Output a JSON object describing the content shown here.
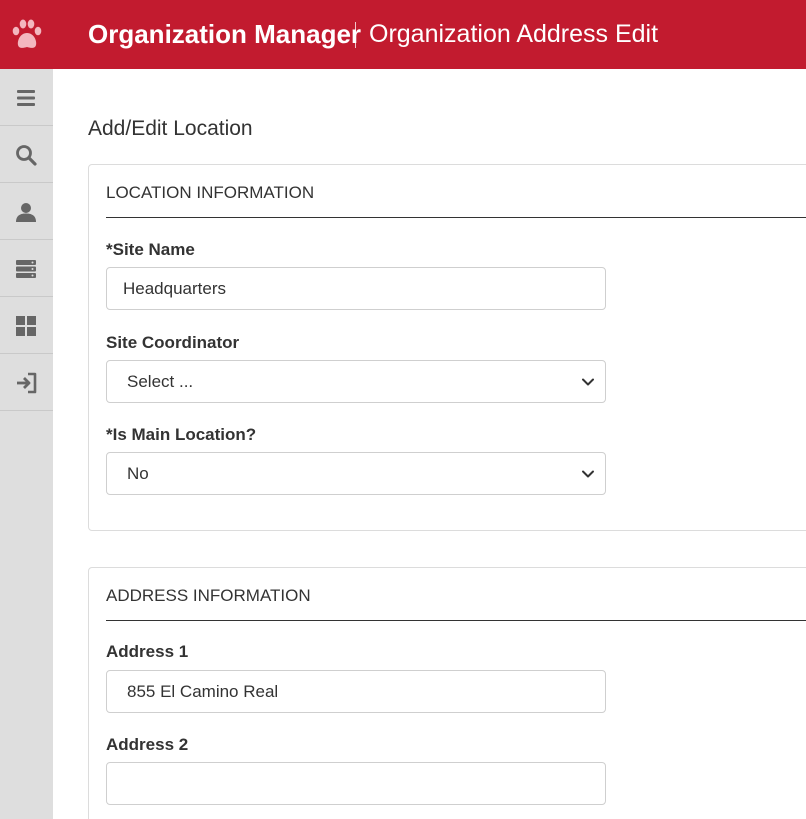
{
  "header": {
    "app_title": "Organization Manager",
    "page_title": "Organization Address Edit",
    "brand_color": "#c21b2f"
  },
  "sidebar": {
    "items": [
      {
        "icon": "menu-icon"
      },
      {
        "icon": "search-icon"
      },
      {
        "icon": "user-icon"
      },
      {
        "icon": "server-icon"
      },
      {
        "icon": "dashboard-icon"
      },
      {
        "icon": "logout-icon"
      }
    ]
  },
  "main": {
    "title": "Add/Edit Location",
    "location_section": {
      "heading": "LOCATION INFORMATION",
      "site_name_label": "*Site Name",
      "site_name_value": "Headquarters",
      "coordinator_label": "Site Coordinator",
      "coordinator_value": "Select ...",
      "main_location_label": "*Is Main Location?",
      "main_location_value": "No"
    },
    "address_section": {
      "heading": "ADDRESS INFORMATION",
      "address1_label": "Address 1",
      "address1_value": "855 El Camino Real",
      "address2_label": "Address 2",
      "address2_value": ""
    }
  }
}
